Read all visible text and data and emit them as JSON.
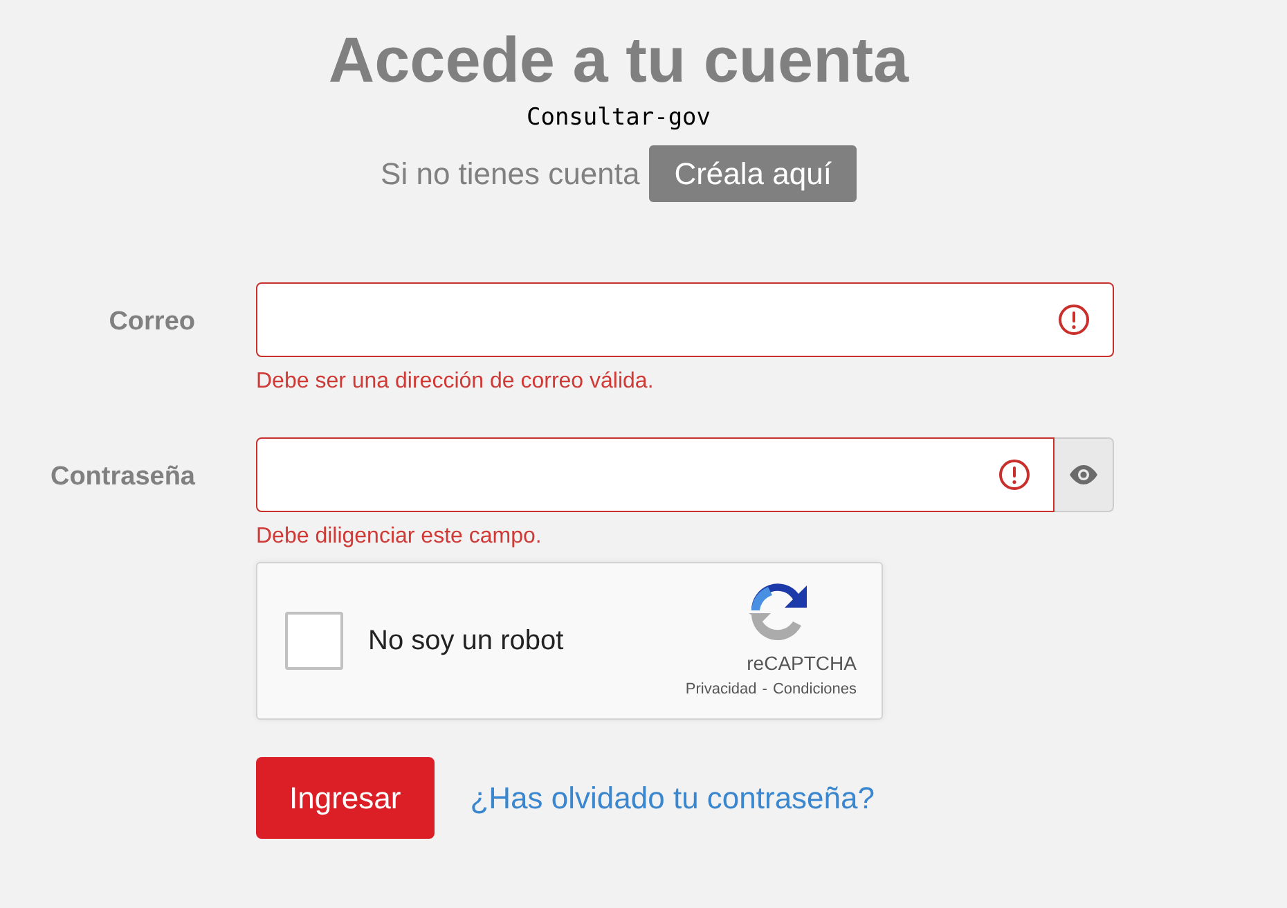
{
  "heading": "Accede a tu cuenta",
  "subtitle": "Consultar-gov",
  "signup": {
    "prompt": "Si no tienes cuenta",
    "button": "Créala aquí"
  },
  "fields": [
    {
      "label": "Correo",
      "kind": "email",
      "invalid": true,
      "error": "Debe ser una dirección de correo válida."
    },
    {
      "label": "Contraseña",
      "kind": "password",
      "invalid": true,
      "error": "Debe diligenciar este campo."
    }
  ],
  "captcha": {
    "label": "No soy un robot",
    "checked": false,
    "brand": "reCAPTCHA",
    "privacy": "Privacidad",
    "separator": "-",
    "terms": "Condiciones"
  },
  "submit": "Ingresar",
  "forgot_link": "¿Has olvidado tu contraseña?"
}
